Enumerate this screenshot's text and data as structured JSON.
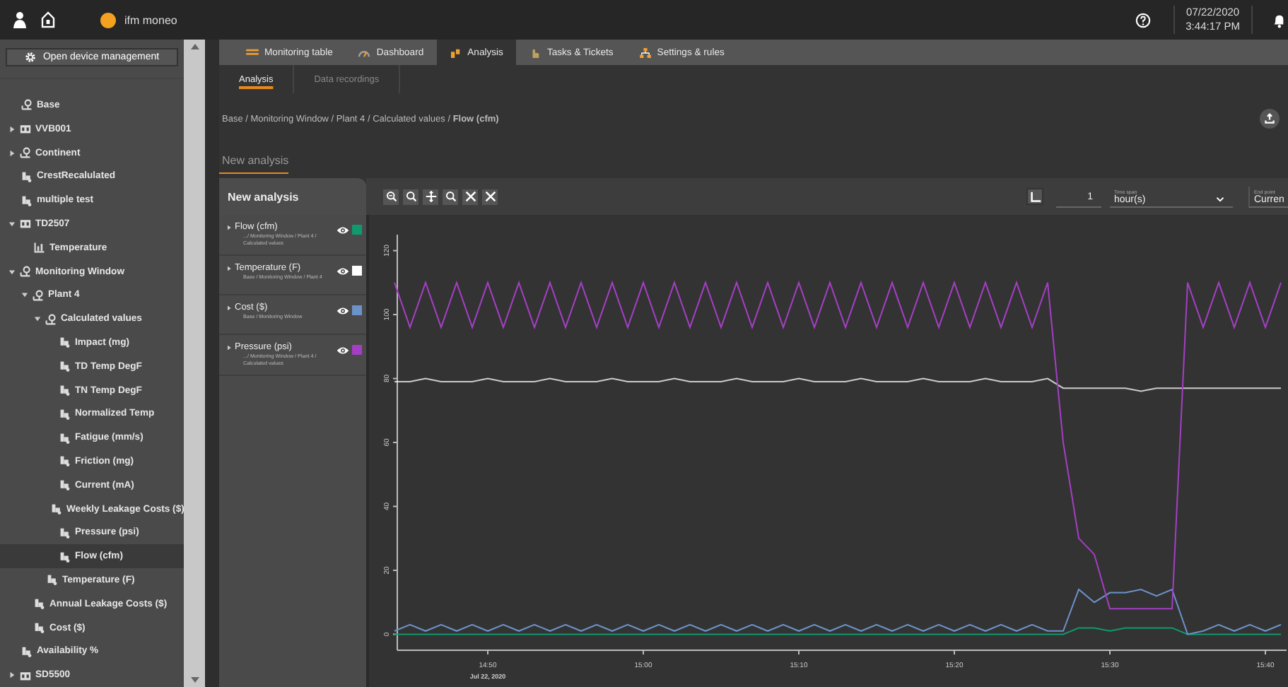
{
  "header": {
    "app_name": "ifm moneo",
    "date": "07/22/2020",
    "time": "3:44:17 PM"
  },
  "sidebar": {
    "button": "Open device management",
    "tree": [
      {
        "label": "Base",
        "kind": "location",
        "selected": false,
        "children": [
          {
            "label": "VVB001",
            "kind": "device",
            "expanded": false,
            "selected": false
          },
          {
            "label": "Continent",
            "kind": "location",
            "expanded": false,
            "selected": false
          },
          {
            "label": "CrestRecalulated",
            "kind": "sensor",
            "selected": false
          },
          {
            "label": "multiple test",
            "kind": "sensor",
            "selected": false
          },
          {
            "label": "TD2507",
            "kind": "device",
            "expanded": true,
            "selected": false,
            "children": [
              {
                "label": "Temperature",
                "kind": "chart",
                "selected": false
              }
            ]
          },
          {
            "label": "Monitoring Window",
            "kind": "location",
            "expanded": true,
            "selected": false,
            "children": [
              {
                "label": "Plant 4",
                "kind": "location",
                "expanded": true,
                "selected": false,
                "children": [
                  {
                    "label": "Calculated values",
                    "kind": "location",
                    "expanded": true,
                    "selected": false,
                    "children": [
                      {
                        "label": "Impact (mg)",
                        "kind": "sensor",
                        "selected": false
                      },
                      {
                        "label": "TD Temp DegF",
                        "kind": "sensor",
                        "selected": false
                      },
                      {
                        "label": "TN Temp DegF",
                        "kind": "sensor",
                        "selected": false
                      },
                      {
                        "label": "Normalized Temp",
                        "kind": "sensor",
                        "selected": false
                      },
                      {
                        "label": "Fatigue (mm/s)",
                        "kind": "sensor",
                        "selected": false
                      },
                      {
                        "label": "Friction (mg)",
                        "kind": "sensor",
                        "selected": false
                      },
                      {
                        "label": "Current (mA)",
                        "kind": "sensor",
                        "selected": false
                      },
                      {
                        "label": "Weekly Leakage Costs ($)",
                        "kind": "sensor",
                        "selected": false
                      },
                      {
                        "label": "Pressure (psi)",
                        "kind": "sensor",
                        "selected": false
                      },
                      {
                        "label": "Flow (cfm)",
                        "kind": "sensor",
                        "selected": true
                      }
                    ]
                  },
                  {
                    "label": "Temperature (F)",
                    "kind": "sensor",
                    "selected": false
                  }
                ]
              },
              {
                "label": "Annual Leakage Costs ($)",
                "kind": "sensor",
                "selected": false
              },
              {
                "label": "Cost ($)",
                "kind": "sensor",
                "selected": false
              }
            ]
          },
          {
            "label": "Availability %",
            "kind": "sensor",
            "selected": false
          },
          {
            "label": "SD5500",
            "kind": "device",
            "expanded": false,
            "selected": false
          }
        ]
      }
    ]
  },
  "tabs": [
    {
      "label": "Monitoring table",
      "kind": "table",
      "selected": false
    },
    {
      "label": "Dashboard",
      "kind": "gauge",
      "selected": false
    },
    {
      "label": "Analysis",
      "kind": "analysis",
      "selected": true
    },
    {
      "label": "Tasks & Tickets",
      "kind": "tasks",
      "selected": false
    },
    {
      "label": "Settings & rules",
      "kind": "rules",
      "selected": false
    }
  ],
  "subtabs": [
    {
      "label": "Analysis",
      "selected": true
    },
    {
      "label": "Data recordings",
      "selected": false
    }
  ],
  "breadcrumb": "Base / Monitoring Window / Plant 4 / Calculated values / **Flow (cfm)**",
  "section_title": "New analysis",
  "panel": {
    "title": "New analysis",
    "tools": [
      {
        "kind": "zoom-in"
      },
      {
        "kind": "zoom-out"
      },
      {
        "kind": "pan"
      },
      {
        "kind": "zoom"
      },
      {
        "kind": "x"
      },
      {
        "kind": "x"
      }
    ],
    "count": "1",
    "time_span_label": "Time span",
    "time_span": "hour(s)",
    "end_point_label": "End point",
    "end_point": "Curren"
  },
  "series": [
    {
      "path": ".../ Monitoring Window / Plant 4 / Calculated values"
    },
    {
      "path": "Base / Monitoring Window / Plant 4"
    },
    {
      "path": "Base / Monitoring Window"
    },
    {
      "path": ".../ Monitoring Window / Plant 4 / Calculated values"
    }
  ],
  "chart": {
    "date_label": "Jul 22, 2020",
    "chart_data": {
      "type": "line",
      "categories": [
        null,
        null,
        null,
        null,
        null,
        null,
        "14:50",
        null,
        null,
        null,
        null,
        null,
        null,
        null,
        null,
        null,
        "15:00",
        null,
        null,
        null,
        null,
        null,
        null,
        null,
        null,
        null,
        "15:10",
        null,
        null,
        null,
        null,
        null,
        null,
        null,
        null,
        null,
        "15:20",
        null,
        null,
        null,
        null,
        null,
        null,
        null,
        null,
        null,
        "15:30",
        null,
        null,
        null,
        null,
        null,
        null,
        null,
        null,
        null,
        "15:40",
        null
      ],
      "series": [
        {
          "name": "Flow (cfm)",
          "color": "#0f9a6e",
          "values": [
            0,
            0,
            0,
            0,
            0,
            0,
            0,
            0,
            0,
            0,
            0,
            0,
            0,
            0,
            0,
            0,
            0,
            0,
            0,
            0,
            0,
            0,
            0,
            0,
            0,
            0,
            0,
            0,
            0,
            0,
            0,
            0,
            0,
            0,
            0,
            0,
            0,
            0,
            0,
            0,
            0,
            0,
            0,
            0,
            2,
            2,
            1,
            2,
            2,
            2,
            2,
            0,
            0,
            0,
            0,
            0,
            0,
            0
          ]
        },
        {
          "name": "Temperature (F)",
          "color": "#ffffff",
          "values": [
            79,
            79,
            80,
            79,
            79,
            79,
            80,
            79,
            79,
            79,
            80,
            79,
            79,
            79,
            80,
            79,
            79,
            79,
            80,
            79,
            79,
            79,
            80,
            79,
            79,
            79,
            80,
            79,
            79,
            79,
            80,
            79,
            79,
            79,
            80,
            79,
            79,
            79,
            80,
            79,
            79,
            79,
            80,
            77,
            77,
            77,
            77,
            77,
            76,
            77,
            77,
            77,
            77,
            77,
            77,
            77,
            77,
            77
          ]
        },
        {
          "name": "Cost ($)",
          "color": "#6b93c9",
          "values": [
            1,
            3,
            1,
            3,
            1,
            3,
            1,
            3,
            1,
            3,
            1,
            3,
            1,
            3,
            1,
            3,
            1,
            3,
            1,
            3,
            1,
            3,
            1,
            3,
            1,
            3,
            1,
            3,
            1,
            3,
            1,
            3,
            1,
            3,
            1,
            3,
            1,
            3,
            1,
            3,
            1,
            3,
            1,
            1,
            14,
            10,
            13,
            13,
            14,
            12,
            14,
            0,
            1,
            3,
            1,
            3,
            1,
            3
          ]
        },
        {
          "name": "Pressure (psi)",
          "color": "#a43fc4",
          "values": [
            110,
            96,
            110,
            96,
            110,
            96,
            110,
            96,
            110,
            96,
            110,
            96,
            110,
            96,
            110,
            96,
            110,
            96,
            110,
            96,
            110,
            96,
            110,
            96,
            110,
            96,
            110,
            96,
            110,
            96,
            110,
            96,
            110,
            96,
            110,
            96,
            110,
            96,
            110,
            96,
            110,
            96,
            110,
            60,
            30,
            25,
            8,
            8,
            8,
            8,
            8,
            110,
            96,
            110,
            96,
            110,
            96,
            110
          ]
        }
      ],
      "ylim": [
        -5,
        125
      ],
      "yticks": [
        0,
        20,
        40,
        60,
        80,
        100,
        120
      ]
    }
  }
}
